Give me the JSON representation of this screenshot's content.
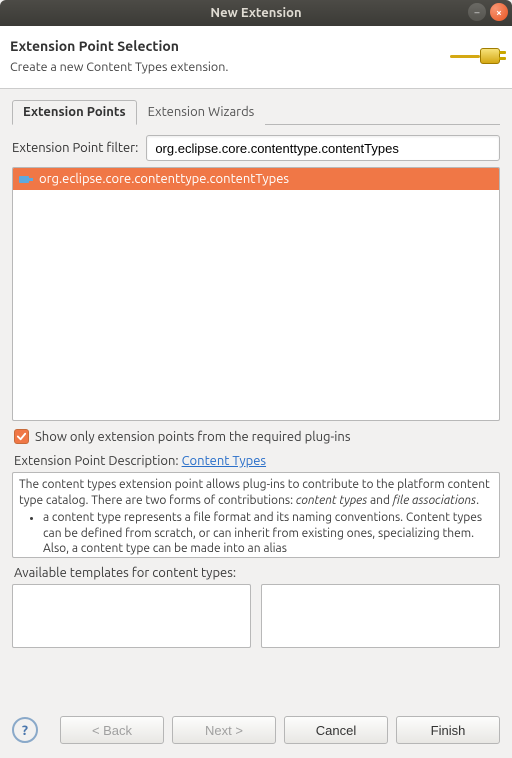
{
  "window": {
    "title": "New Extension"
  },
  "header": {
    "title": "Extension Point Selection",
    "subtitle": "Create a new Content Types extension."
  },
  "tabs": {
    "t1": "Extension Points",
    "t2": "Extension Wizards"
  },
  "filter": {
    "label": "Extension Point filter:",
    "value": "org.eclipse.core.contenttype.contentTypes"
  },
  "list": {
    "item0": "org.eclipse.core.contenttype.contentTypes"
  },
  "required_checkbox": {
    "label": "Show only extension points from the required plug-ins",
    "checked": true
  },
  "description": {
    "label_prefix": "Extension Point Description: ",
    "link": "Content Types",
    "line1a": "The content types extension point allows plug-ins to contribute to the platform content type catalog. There are two forms of contributions: ",
    "em1": "content types",
    "mid": " and ",
    "em2": "file associations",
    "bullet1": "a content type represents a file format and its naming conventions. Content types can be defined from scratch, or can inherit from existing ones, specializing them. Also, a content type can be made into an alias"
  },
  "templates": {
    "label": "Available templates for content types:"
  },
  "buttons": {
    "back": "< Back",
    "next": "Next >",
    "cancel": "Cancel",
    "finish": "Finish"
  }
}
